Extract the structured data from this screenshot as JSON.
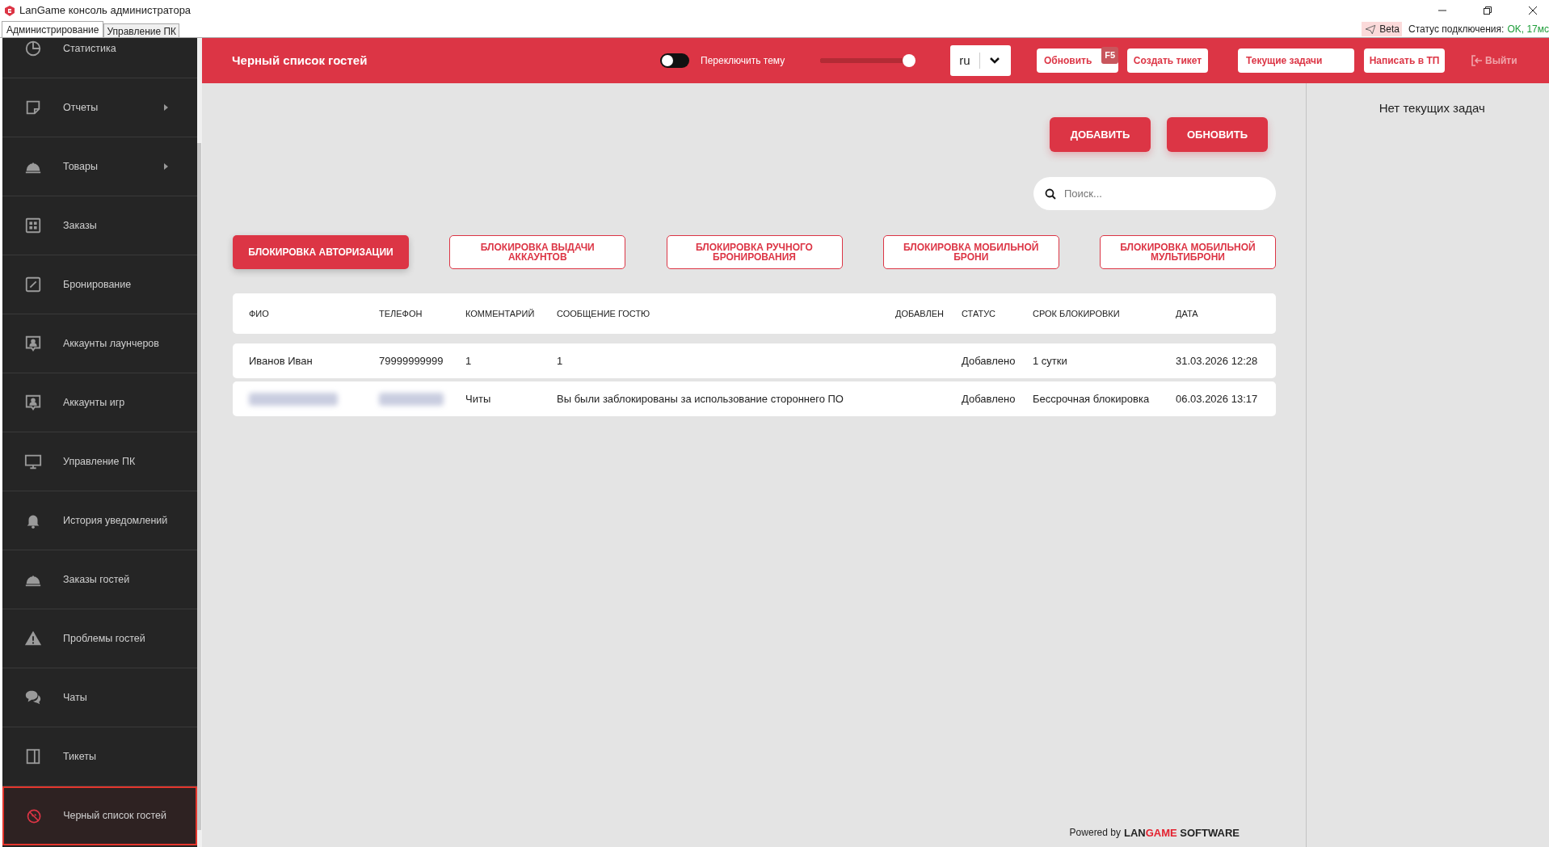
{
  "window": {
    "title": "LanGame консоль администратора",
    "tabs": [
      {
        "label": "Администрирование",
        "selected": true
      },
      {
        "label": "Управление ПК",
        "selected": false
      }
    ],
    "beta": "Beta",
    "status_label": "Статус подключения:",
    "status_value": "OK, 17мс"
  },
  "sidebar": {
    "items": [
      {
        "label": "Статистика",
        "kind": "pie",
        "submenu": false,
        "selected": false
      },
      {
        "label": "Отчеты",
        "kind": "note",
        "submenu": true,
        "selected": false
      },
      {
        "label": "Товары",
        "kind": "cloche",
        "submenu": true,
        "selected": false
      },
      {
        "label": "Заказы",
        "kind": "grid",
        "submenu": false,
        "selected": false
      },
      {
        "label": "Бронирование",
        "kind": "edit",
        "submenu": false,
        "selected": false
      },
      {
        "label": "Аккаунты лаунчеров",
        "kind": "account",
        "submenu": false,
        "selected": false
      },
      {
        "label": "Аккаунты игр",
        "kind": "account",
        "submenu": false,
        "selected": false
      },
      {
        "label": "Управление ПК",
        "kind": "monitor",
        "submenu": false,
        "selected": false
      },
      {
        "label": "История уведомлений",
        "kind": "bell",
        "submenu": false,
        "selected": false
      },
      {
        "label": "Заказы гостей",
        "kind": "cloche",
        "submenu": false,
        "selected": false
      },
      {
        "label": "Проблемы гостей",
        "kind": "warning",
        "submenu": false,
        "selected": false
      },
      {
        "label": "Чаты",
        "kind": "chat",
        "submenu": false,
        "selected": false
      },
      {
        "label": "Тикеты",
        "kind": "book",
        "submenu": false,
        "selected": false
      },
      {
        "label": "Черный список гостей",
        "kind": "ban",
        "submenu": false,
        "selected": true
      }
    ]
  },
  "header": {
    "title": "Черный список гостей",
    "theme_toggle": {
      "label": "Переключить тему",
      "on": false
    },
    "slider": {
      "level": 0.93
    },
    "language": "ru",
    "refresh": "Обновить",
    "refresh_key": "F5",
    "create_ticket": "Создать тикет",
    "current_tasks": "Текущие задачи",
    "write_support": "Написать в ТП",
    "logout": "Выйти"
  },
  "actions": [
    "ДОБАВИТЬ",
    "ОБНОВИТЬ"
  ],
  "search": {
    "placeholder": "Поиск..."
  },
  "block_tabs": [
    {
      "label": "БЛОКИРОВКА АВТОРИЗАЦИИ",
      "selected": true
    },
    {
      "label": "БЛОКИРОВКА ВЫДАЧИ АККАУНТОВ",
      "selected": false
    },
    {
      "label": "БЛОКИРОВКА РУЧНОГО БРОНИРОВАНИЯ",
      "selected": false
    },
    {
      "label": "БЛОКИРОВКА МОБИЛЬНОЙ БРОНИ",
      "selected": false
    },
    {
      "label": "БЛОКИРОВКА МОБИЛЬНОЙ МУЛЬТИБРОНИ",
      "selected": false
    }
  ],
  "table": {
    "columns": [
      "ФИО",
      "ТЕЛЕФОН",
      "КОММЕНТАРИЙ",
      "СООБЩЕНИЕ ГОСТЮ",
      "ДОБАВЛЕН",
      "СТАТУС",
      "СРОК БЛОКИРОВКИ",
      "ДАТА"
    ],
    "rows": [
      {
        "cells": [
          {
            "text": "Иванов Иван"
          },
          {
            "text": "79999999999"
          },
          {
            "text": "1"
          },
          {
            "text": "1"
          },
          {},
          {
            "text": "Добавлено"
          },
          {
            "text": "1 сутки"
          },
          {
            "text": "31.03.2026 12:28"
          }
        ]
      },
      {
        "cells": [
          {
            "redacted": true
          },
          {
            "redacted": true
          },
          {
            "text": "Читы"
          },
          {
            "text": "Вы были заблокированы за использование стороннего ПО"
          },
          {},
          {
            "text": "Добавлено"
          },
          {
            "text": "Бессрочная блокировка"
          },
          {
            "text": "06.03.2026 13:17"
          }
        ]
      }
    ]
  },
  "tasks_panel": {
    "empty_text": "Нет текущих задач"
  },
  "footer": {
    "prefix": "Powered by",
    "brand_a": "LAN",
    "brand_b": "GAME",
    "brand_c": "SOFTWARE"
  }
}
